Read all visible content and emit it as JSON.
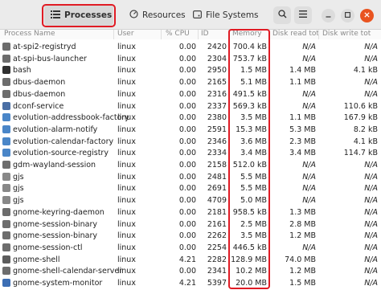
{
  "tabs": [
    {
      "label": "Processes"
    },
    {
      "label": "Resources"
    },
    {
      "label": "File Systems"
    }
  ],
  "columns": {
    "process_name": "Process Name",
    "user": "User",
    "cpu": "% CPU",
    "id": "ID",
    "memory": "Memory",
    "disk_read": "Disk read tot",
    "disk_write": "Disk write tot"
  },
  "processes": [
    {
      "name": "at-spi2-registryd",
      "user": "linux",
      "cpu": "0.00",
      "id": "2420",
      "memory": "700.4 kB",
      "disk_read": "N/A",
      "disk_write": "N/A"
    },
    {
      "name": "at-spi-bus-launcher",
      "user": "linux",
      "cpu": "0.00",
      "id": "2304",
      "memory": "753.7 kB",
      "disk_read": "N/A",
      "disk_write": "N/A"
    },
    {
      "name": "bash",
      "user": "linux",
      "cpu": "0.00",
      "id": "2950",
      "memory": "1.5 MB",
      "disk_read": "1.4 MB",
      "disk_write": "4.1 kB"
    },
    {
      "name": "dbus-daemon",
      "user": "linux",
      "cpu": "0.00",
      "id": "2165",
      "memory": "5.1 MB",
      "disk_read": "1.1 MB",
      "disk_write": "N/A"
    },
    {
      "name": "dbus-daemon",
      "user": "linux",
      "cpu": "0.00",
      "id": "2316",
      "memory": "491.5 kB",
      "disk_read": "N/A",
      "disk_write": "N/A"
    },
    {
      "name": "dconf-service",
      "user": "linux",
      "cpu": "0.00",
      "id": "2337",
      "memory": "569.3 kB",
      "disk_read": "N/A",
      "disk_write": "110.6 kB"
    },
    {
      "name": "evolution-addressbook-factory",
      "user": "linux",
      "cpu": "0.00",
      "id": "2380",
      "memory": "3.5 MB",
      "disk_read": "1.1 MB",
      "disk_write": "167.9 kB"
    },
    {
      "name": "evolution-alarm-notify",
      "user": "linux",
      "cpu": "0.00",
      "id": "2591",
      "memory": "15.3 MB",
      "disk_read": "5.3 MB",
      "disk_write": "8.2 kB"
    },
    {
      "name": "evolution-calendar-factory",
      "user": "linux",
      "cpu": "0.00",
      "id": "2346",
      "memory": "3.6 MB",
      "disk_read": "2.3 MB",
      "disk_write": "4.1 kB"
    },
    {
      "name": "evolution-source-registry",
      "user": "linux",
      "cpu": "0.00",
      "id": "2334",
      "memory": "3.4 MB",
      "disk_read": "3.4 MB",
      "disk_write": "114.7 kB"
    },
    {
      "name": "gdm-wayland-session",
      "user": "linux",
      "cpu": "0.00",
      "id": "2158",
      "memory": "512.0 kB",
      "disk_read": "N/A",
      "disk_write": "N/A"
    },
    {
      "name": "gjs",
      "user": "linux",
      "cpu": "0.00",
      "id": "2481",
      "memory": "5.5 MB",
      "disk_read": "N/A",
      "disk_write": "N/A"
    },
    {
      "name": "gjs",
      "user": "linux",
      "cpu": "0.00",
      "id": "2691",
      "memory": "5.5 MB",
      "disk_read": "N/A",
      "disk_write": "N/A"
    },
    {
      "name": "gjs",
      "user": "linux",
      "cpu": "0.00",
      "id": "4709",
      "memory": "5.0 MB",
      "disk_read": "N/A",
      "disk_write": "N/A"
    },
    {
      "name": "gnome-keyring-daemon",
      "user": "linux",
      "cpu": "0.00",
      "id": "2181",
      "memory": "958.5 kB",
      "disk_read": "1.3 MB",
      "disk_write": "N/A"
    },
    {
      "name": "gnome-session-binary",
      "user": "linux",
      "cpu": "0.00",
      "id": "2161",
      "memory": "2.5 MB",
      "disk_read": "2.8 MB",
      "disk_write": "N/A"
    },
    {
      "name": "gnome-session-binary",
      "user": "linux",
      "cpu": "0.00",
      "id": "2262",
      "memory": "3.5 MB",
      "disk_read": "1.2 MB",
      "disk_write": "N/A"
    },
    {
      "name": "gnome-session-ctl",
      "user": "linux",
      "cpu": "0.00",
      "id": "2254",
      "memory": "446.5 kB",
      "disk_read": "N/A",
      "disk_write": "N/A"
    },
    {
      "name": "gnome-shell",
      "user": "linux",
      "cpu": "4.21",
      "id": "2282",
      "memory": "128.9 MB",
      "disk_read": "74.0 MB",
      "disk_write": "N/A"
    },
    {
      "name": "gnome-shell-calendar-server",
      "user": "linux",
      "cpu": "0.00",
      "id": "2341",
      "memory": "10.2 MB",
      "disk_read": "1.2 MB",
      "disk_write": "N/A"
    },
    {
      "name": "gnome-system-monitor",
      "user": "linux",
      "cpu": "4.21",
      "id": "5397",
      "memory": "20.0 MB",
      "disk_read": "1.5 MB",
      "disk_write": "N/A"
    }
  ],
  "icons": {
    "view_tab_icon": "list-icon",
    "resources_icon": "gauge-icon",
    "filesystems_icon": "hard-drive-icon",
    "search": "search-icon",
    "menu": "hamburger-menu-icon",
    "minimize": "minimize-icon",
    "maximize": "maximize-icon",
    "close": "close-icon"
  },
  "colors": {
    "highlight_outline": "#e01b24",
    "close_button": "#e95420"
  }
}
